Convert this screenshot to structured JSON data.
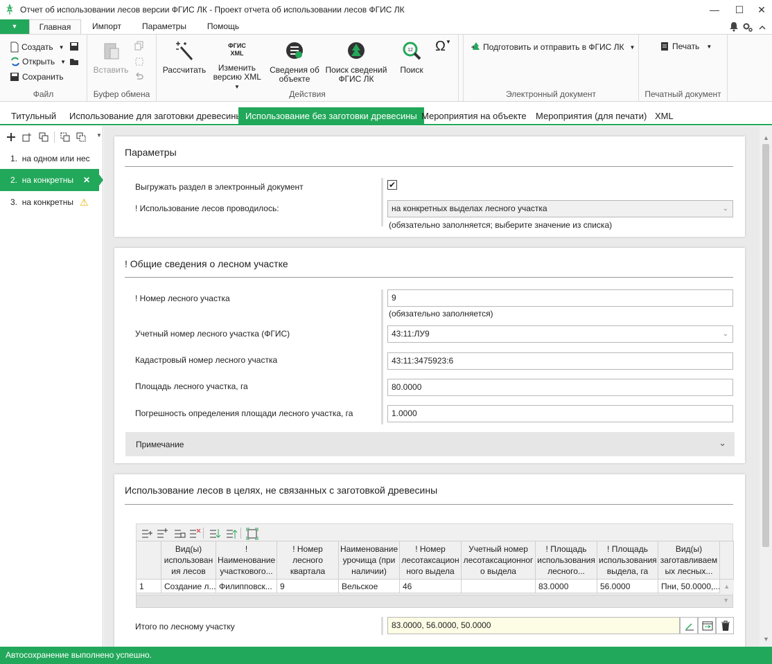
{
  "window": {
    "title": "Отчет об использовании лесов версии ФГИС ЛК - Проект отчета об использовании лесов ФГИС ЛК",
    "minimize": "—",
    "maximize": "☐",
    "close": "✕"
  },
  "menu_tabs": {
    "file_arrow": "▼",
    "items": [
      "Главная",
      "Импорт",
      "Параметры",
      "Помощь"
    ]
  },
  "ribbon": {
    "file_group": {
      "label": "Файл",
      "create": "Создать",
      "open": "Открыть",
      "save": "Сохранить"
    },
    "clipboard_group": {
      "label": "Буфер обмена",
      "paste": "Вставить"
    },
    "actions_group": {
      "label": "Действия",
      "calculate": "Рассчитать",
      "change_xml_1": "Изменить",
      "change_xml_2": "версию XML",
      "fgis_badge_1": "ФГИС",
      "fgis_badge_2": "XML",
      "object_info_1": "Сведения об",
      "object_info_2": "объекте",
      "search_fgis_1": "Поиск сведений",
      "search_fgis_2": "ФГИС ЛК",
      "search": "Поиск",
      "omega": "Ω"
    },
    "edoc_group": {
      "label": "Электронный документ",
      "prepare": "Подготовить и отправить в ФГИС ЛК"
    },
    "print_group": {
      "label": "Печатный документ",
      "print": "Печать"
    }
  },
  "page_tabs": [
    "Титульный",
    "Использование для заготовки древесины",
    "Использование без заготовки древесины",
    "Мероприятия на объекте",
    "Мероприятия (для печати)",
    "XML"
  ],
  "left_panel": {
    "items": [
      {
        "num": "1.",
        "label": "на одном или нес"
      },
      {
        "num": "2.",
        "label": "на конкретны",
        "mark": "✕"
      },
      {
        "num": "3.",
        "label": "на конкретны",
        "mark": "⚠"
      }
    ]
  },
  "params": {
    "title": "Параметры",
    "export_label": "Выгружать раздел в электронный документ",
    "export_checked": "✔",
    "usage_label": "! Использование лесов проводилось:",
    "usage_value": "на конкретных выделах лесного участка",
    "usage_hint": "(обязательно заполняется; выберите значение из списка)"
  },
  "general": {
    "title": "! Общие сведения о лесном участке",
    "plot_number_label": "! Номер лесного участка",
    "plot_number_value": "9",
    "plot_number_hint": "(обязательно заполняется)",
    "account_number_label": "Учетный номер лесного участка (ФГИС)",
    "account_number_value": "43:11:ЛУ9",
    "cadastral_label": "Кадастровый номер лесного участка",
    "cadastral_value": "43:11:3475923:6",
    "area_label": "Площадь лесного участка, га",
    "area_value": "80.0000",
    "error_label": "Погрешность определения площади лесного участка, га",
    "error_value": "1.0000",
    "note_label": "Примечание"
  },
  "usage": {
    "title": "Использование лесов в целях, не связанных с заготовкой древесины",
    "columns": [
      [
        "Вид(ы)",
        "использован",
        "ия лесов"
      ],
      [
        "!",
        "Наименование",
        "участкового..."
      ],
      [
        "! Номер",
        "лесного",
        "квартала"
      ],
      [
        "Наименование",
        "урочища (при",
        "наличии)"
      ],
      [
        "! Номер",
        "лесотаксацион",
        "ного выдела"
      ],
      [
        "Учетный номер",
        "лесотаксационног",
        "о выдела"
      ],
      [
        "! Площадь",
        "использования",
        "лесного..."
      ],
      [
        "! Площадь",
        "использования",
        "выдела, га"
      ],
      [
        "Вид(ы)",
        "заготавливаем",
        "ых лесных..."
      ]
    ],
    "rows": [
      [
        "1",
        "Создание л...",
        "Филипповск...",
        "9",
        "Вельское",
        "46",
        "",
        "83.0000",
        "56.0000",
        "Пни, 50.0000,..."
      ]
    ],
    "total_label": "Итого по лесному участку",
    "total_value": "83.0000, 56.0000, 50.0000"
  },
  "status": "Автосохранение выполнено успешно."
}
